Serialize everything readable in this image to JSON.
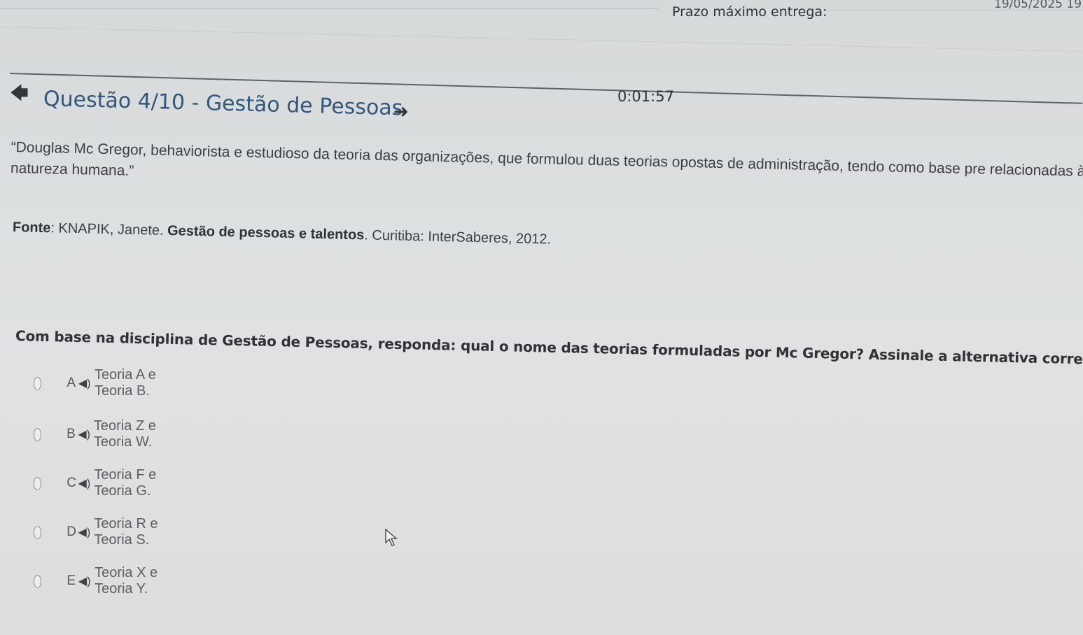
{
  "header": {
    "deadline_label": "Prazo máximo entrega:",
    "deadline_value": "19/05/2025 19",
    "timer": "0:01:57"
  },
  "question": {
    "title": "Questão 4/10 - Gestão de Pessoas",
    "quote": "“Douglas Mc Gregor, behaviorista e estudioso da teoria das organizações, que formulou duas teorias opostas de administração, tendo como base pre relacionadas à natureza humana.”",
    "source_label": "Fonte",
    "source_author": ": KNAPIK, Janete. ",
    "source_book": "Gestão de pessoas e talentos",
    "source_rest": ". Curitiba: InterSaberes, 2012.",
    "prompt": "Com base na disciplina de Gestão de Pessoas, responda: qual o nome das teorias formuladas por Mc Gregor? Assinale a alternativa correta:"
  },
  "options": [
    {
      "letter": "A",
      "text": "Teoria A e Teoria B."
    },
    {
      "letter": "B",
      "text": "Teoria Z e Teoria W."
    },
    {
      "letter": "C",
      "text": "Teoria F e Teoria G."
    },
    {
      "letter": "D",
      "text": "Teoria R e Teoria S."
    },
    {
      "letter": "E",
      "text": "Teoria X e Teoria Y."
    }
  ],
  "icons": {
    "back": "arrow-left-icon",
    "forward": "arrow-right-icon",
    "audio": "speaker-icon",
    "cursor": "mouse-pointer-icon"
  },
  "colors": {
    "title": "#31577a",
    "text": "#3b3f43",
    "background": "#dcdfe0"
  }
}
